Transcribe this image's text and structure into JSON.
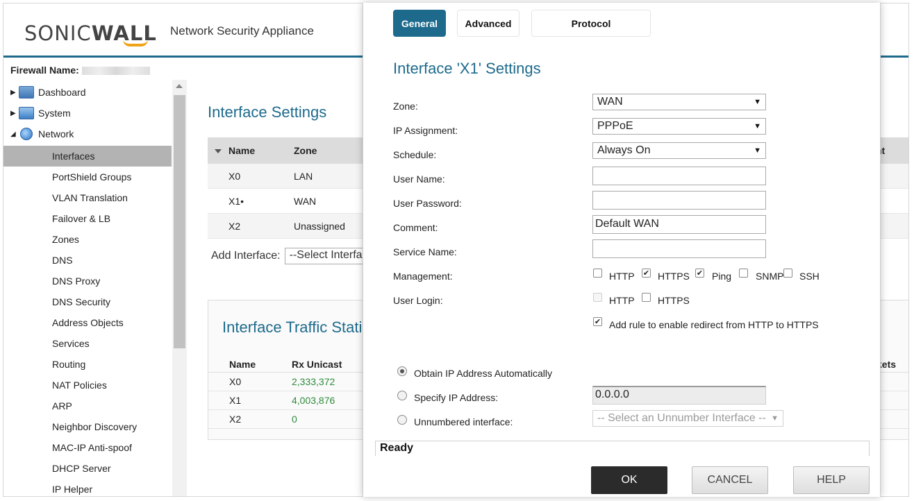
{
  "app": {
    "brand_prefix": "SONIC",
    "brand_suffix": "WALL",
    "title": "Network Security Appliance",
    "firewall_name_label": "Firewall Name:"
  },
  "sidebar": {
    "top_items": [
      {
        "label": "Dashboard",
        "icon": "dashboard-icon",
        "expanded": false
      },
      {
        "label": "System",
        "icon": "monitor-icon",
        "expanded": false
      },
      {
        "label": "Network",
        "icon": "globe-icon",
        "expanded": true
      }
    ],
    "network_items": [
      "Interfaces",
      "PortShield Groups",
      "VLAN Translation",
      "Failover & LB",
      "Zones",
      "DNS",
      "DNS Proxy",
      "DNS Security",
      "Address Objects",
      "Services",
      "Routing",
      "NAT Policies",
      "ARP",
      "Neighbor Discovery",
      "MAC-IP Anti-spoof",
      "DHCP Server",
      "IP Helper"
    ],
    "active_item": "Interfaces"
  },
  "main": {
    "title": "Interface Settings",
    "table": {
      "headers": [
        "Name",
        "Zone",
        "nt"
      ],
      "rows": [
        {
          "name": "X0",
          "zone": "LAN"
        },
        {
          "name": "X1•",
          "zone": "WAN"
        },
        {
          "name": "X2",
          "zone": "Unassigned"
        }
      ]
    },
    "add_interface_label": "Add Interface:",
    "add_interface_value": "--Select Interface--",
    "traffic": {
      "title": "Interface Traffic Statistics",
      "headers": [
        "Name",
        "Rx Unicast",
        "kets"
      ],
      "rows": [
        {
          "name": "X0",
          "rx": "2,333,372"
        },
        {
          "name": "X1",
          "rx": "4,003,876"
        },
        {
          "name": "X2",
          "rx": "0"
        }
      ]
    }
  },
  "dialog": {
    "tabs": [
      "General",
      "Advanced",
      "Protocol"
    ],
    "active_tab": "General",
    "title": "Interface 'X1' Settings",
    "fields": {
      "zone_label": "Zone:",
      "zone_value": "WAN",
      "ip_assignment_label": "IP Assignment:",
      "ip_assignment_value": "PPPoE",
      "schedule_label": "Schedule:",
      "schedule_value": "Always On",
      "username_label": "User Name:",
      "username_value": "",
      "password_label": "User Password:",
      "password_value": "",
      "comment_label": "Comment:",
      "comment_value": "Default WAN",
      "service_name_label": "Service Name:",
      "service_name_value": ""
    },
    "management": {
      "label": "Management:",
      "options": [
        {
          "label": "HTTP",
          "checked": false
        },
        {
          "label": "HTTPS",
          "checked": true
        },
        {
          "label": "Ping",
          "checked": true
        },
        {
          "label": "SNMP",
          "checked": false
        },
        {
          "label": "SSH",
          "checked": false
        }
      ]
    },
    "user_login": {
      "label": "User Login:",
      "options": [
        {
          "label": "HTTP",
          "checked": false,
          "disabled": true
        },
        {
          "label": "HTTPS",
          "checked": false,
          "disabled": false
        }
      ]
    },
    "redirect_label": "Add rule to enable redirect from HTTP to HTTPS",
    "redirect_checked": true,
    "ip_options": [
      {
        "label": "Obtain IP Address Automatically",
        "selected": true
      },
      {
        "label": "Specify IP Address:",
        "selected": false
      },
      {
        "label": "Unnumbered interface:",
        "selected": false
      }
    ],
    "ip_address_value": "0.0.0.0",
    "unnumbered_placeholder": "-- Select an Unnumber Interface --",
    "status": "Ready",
    "buttons": {
      "ok": "OK",
      "cancel": "CANCEL",
      "help": "HELP"
    }
  },
  "colors": {
    "accent": "#1d6a8c",
    "logo_orange": "#f0a216",
    "ok_button": "#2b2b2b",
    "traffic_green": "#2e8b3a"
  }
}
